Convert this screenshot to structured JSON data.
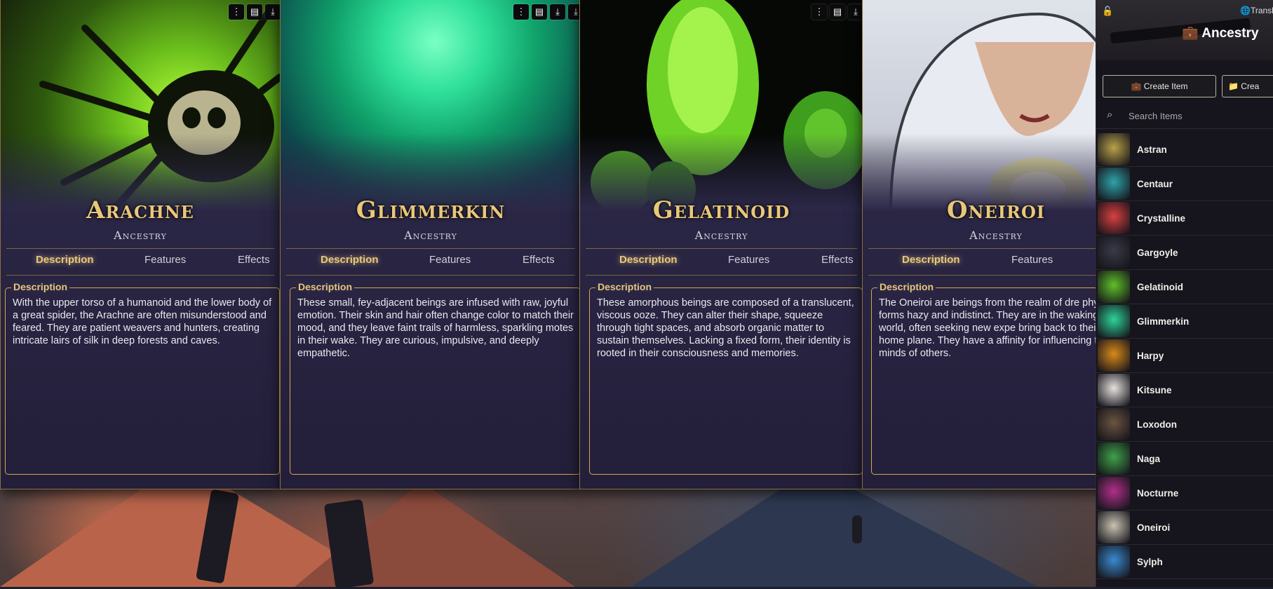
{
  "sheets": [
    {
      "title": "Arachne",
      "subtitle": "Ancestry",
      "tabs": [
        "Description",
        "Features",
        "Effects"
      ],
      "legend": "Description",
      "description": "With the upper torso of a humanoid and the lower body of a great spider, the Arachne are often misunderstood and feared. They are patient weavers and hunters, creating intricate lairs of silk in deep forests and caves."
    },
    {
      "title": "Glimmerkin",
      "subtitle": "Ancestry",
      "tabs": [
        "Description",
        "Features",
        "Effects"
      ],
      "legend": "Description",
      "description": "These small, fey-adjacent beings are infused with raw, joyful emotion. Their skin and hair often change color to match their mood, and they leave faint trails of harmless, sparkling motes in their wake. They are curious, impulsive, and deeply empathetic."
    },
    {
      "title": "Gelatinoid",
      "subtitle": "Ancestry",
      "tabs": [
        "Description",
        "Features",
        "Effects"
      ],
      "legend": "Description",
      "description": "These amorphous beings are composed of a translucent, viscous ooze. They can alter their shape, squeeze through tight spaces, and absorb organic matter to sustain themselves. Lacking a fixed form, their identity is rooted in their consciousness and memories."
    },
    {
      "title": "Oneiroi",
      "subtitle": "Ancestry",
      "tabs": [
        "Description",
        "Features"
      ],
      "legend": "Description",
      "description": "The Oneiroi are beings from the realm of dre physical forms hazy and indistinct. They are in the waking world, often seeking new expe bring back to their home plane. They have a affinity for influencing the minds of others."
    }
  ],
  "sidebar": {
    "title": "Ancestry",
    "translate_label": "Transl",
    "create_item_label": "Create Item",
    "create_folder_label": "Crea",
    "search_placeholder": "Search Items",
    "items": [
      {
        "label": "Astran",
        "color": "#b9a24a"
      },
      {
        "label": "Centaur",
        "color": "#2fa3a8"
      },
      {
        "label": "Crystalline",
        "color": "#d94040"
      },
      {
        "label": "Gargoyle",
        "color": "#3a3a48"
      },
      {
        "label": "Gelatinoid",
        "color": "#5fbf2a"
      },
      {
        "label": "Glimmerkin",
        "color": "#2ed49a"
      },
      {
        "label": "Harpy",
        "color": "#d98a1a"
      },
      {
        "label": "Kitsune",
        "color": "#e6e2de"
      },
      {
        "label": "Loxodon",
        "color": "#6b5442"
      },
      {
        "label": "Naga",
        "color": "#3fa14a"
      },
      {
        "label": "Nocturne",
        "color": "#b0308a"
      },
      {
        "label": "Oneiroi",
        "color": "#c9c3b2"
      },
      {
        "label": "Sylph",
        "color": "#3a8acf"
      }
    ]
  }
}
